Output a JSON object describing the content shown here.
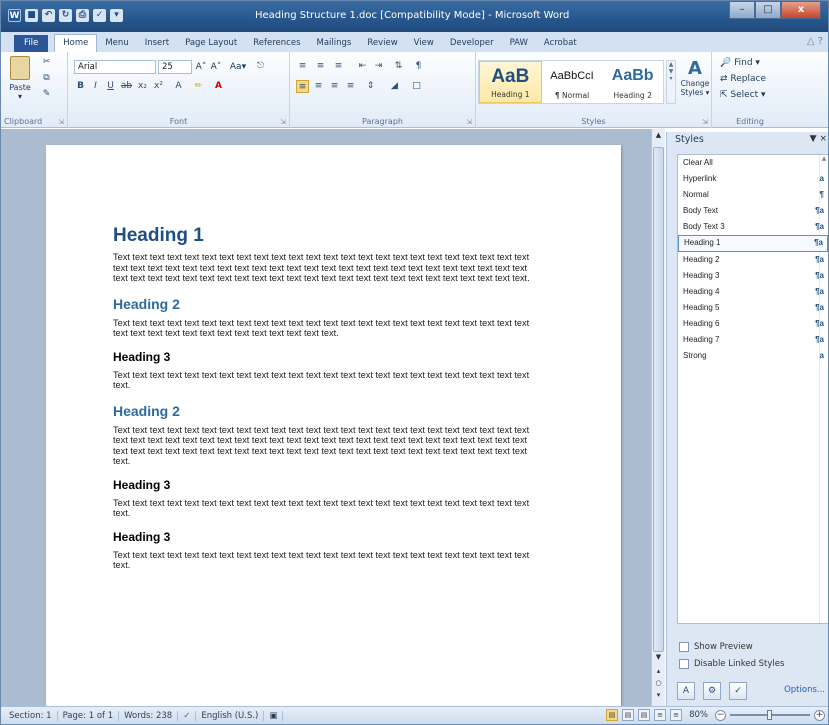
{
  "window": {
    "title": "Heading Structure 1.doc [Compatibility Mode] - Microsoft Word",
    "close": "x",
    "minimize": "–",
    "maximize": "□"
  },
  "tabs": [
    "File",
    "Home",
    "Menu",
    "Insert",
    "Page Layout",
    "References",
    "Mailings",
    "Review",
    "View",
    "Developer",
    "PAW",
    "Acrobat"
  ],
  "ribbon": {
    "clipboard": {
      "label": "Clipboard",
      "paste": "Paste"
    },
    "font": {
      "label": "Font",
      "name": "Arial",
      "size": "25",
      "grow": "A˄",
      "shrink": "A˅",
      "case": "Aa▾"
    },
    "paragraph": {
      "label": "Paragraph"
    },
    "styles": {
      "label": "Styles",
      "gallery": [
        {
          "preview": "AaB",
          "name": "Heading 1",
          "selected": true
        },
        {
          "preview": "AaBbCcI",
          "name": "¶ Normal",
          "selected": false
        },
        {
          "preview": "AaBb",
          "name": "Heading 2",
          "selected": false
        }
      ],
      "change_styles": "Change Styles ▾"
    },
    "editing": {
      "label": "Editing",
      "find": "Find ▾",
      "replace": "Replace",
      "select": "Select ▾"
    }
  },
  "document": [
    {
      "type": "h1",
      "text": "Heading 1"
    },
    {
      "type": "p",
      "text": "Text text text text text text text text text text text text text text text text text text text text text text text text text text text text text text text text text text text text text text text text text text text text text text text text text text text text text text text text text text text text text text text text text text text text text text text text."
    },
    {
      "type": "h2",
      "text": "Heading 2"
    },
    {
      "type": "p",
      "text": "Text text text text text text text text text text text text text text text text text text text text text text text text text text text text text text text text text text text text text."
    },
    {
      "type": "h3",
      "text": "Heading 3"
    },
    {
      "type": "p",
      "text": "Text text text text text text text text text text text text text text text text text text text text text text text text text."
    },
    {
      "type": "h2",
      "text": "Heading 2"
    },
    {
      "type": "p",
      "text": "Text text text text text text text text text text text text text text text text text text text text text text text text text text text text text text text text text text text text text text text text text text text text text text text text text text text text text text text text text text text text text text text text text text text text text text text text text."
    },
    {
      "type": "h3",
      "text": "Heading 3"
    },
    {
      "type": "p",
      "text": "Text text text text text text text text text text text text text text text text text text text text text text text text text."
    },
    {
      "type": "h3",
      "text": "Heading 3"
    },
    {
      "type": "p",
      "text": "Text text text text text text text text text text text text text text text text text text text text text text text text text."
    }
  ],
  "styles_pane": {
    "title": "Styles",
    "items": [
      {
        "name": "Clear All",
        "glyph": ""
      },
      {
        "name": "Hyperlink",
        "glyph": "a"
      },
      {
        "name": "Normal",
        "glyph": "¶"
      },
      {
        "name": "Body Text",
        "glyph": "¶a"
      },
      {
        "name": "Body Text 3",
        "glyph": "¶a"
      },
      {
        "name": "Heading 1",
        "glyph": "¶a",
        "selected": true
      },
      {
        "name": "Heading 2",
        "glyph": "¶a"
      },
      {
        "name": "Heading 3",
        "glyph": "¶a"
      },
      {
        "name": "Heading 4",
        "glyph": "¶a"
      },
      {
        "name": "Heading 5",
        "glyph": "¶a"
      },
      {
        "name": "Heading 6",
        "glyph": "¶a"
      },
      {
        "name": "Heading 7",
        "glyph": "¶a"
      },
      {
        "name": "Strong",
        "glyph": "a"
      }
    ],
    "show_preview": "Show Preview",
    "disable_linked": "Disable Linked Styles",
    "options": "Options..."
  },
  "status": {
    "section": "Section: 1",
    "page": "Page: 1 of 1",
    "words": "Words: 238",
    "language": "English (U.S.)",
    "zoom": "80%",
    "zoom_level": 0.5
  }
}
